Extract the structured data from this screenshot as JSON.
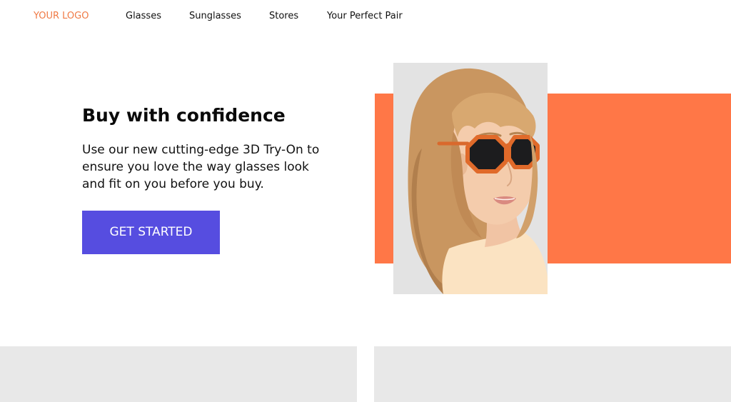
{
  "header": {
    "logo": "YOUR LOGO",
    "nav": [
      {
        "label": "Glasses"
      },
      {
        "label": "Sunglasses"
      },
      {
        "label": "Stores"
      },
      {
        "label": "Your Perfect Pair"
      }
    ]
  },
  "hero": {
    "title": "Buy with confidence",
    "text": "Use our new cutting-edge 3D Try-On to ensure you love the way glasses look and fit on you before you buy.",
    "cta_label": "GET STARTED"
  },
  "colors": {
    "accent": "#f07a45",
    "orange_block": "#ff7747",
    "button": "#564de0",
    "card": "#e8e8e8"
  }
}
